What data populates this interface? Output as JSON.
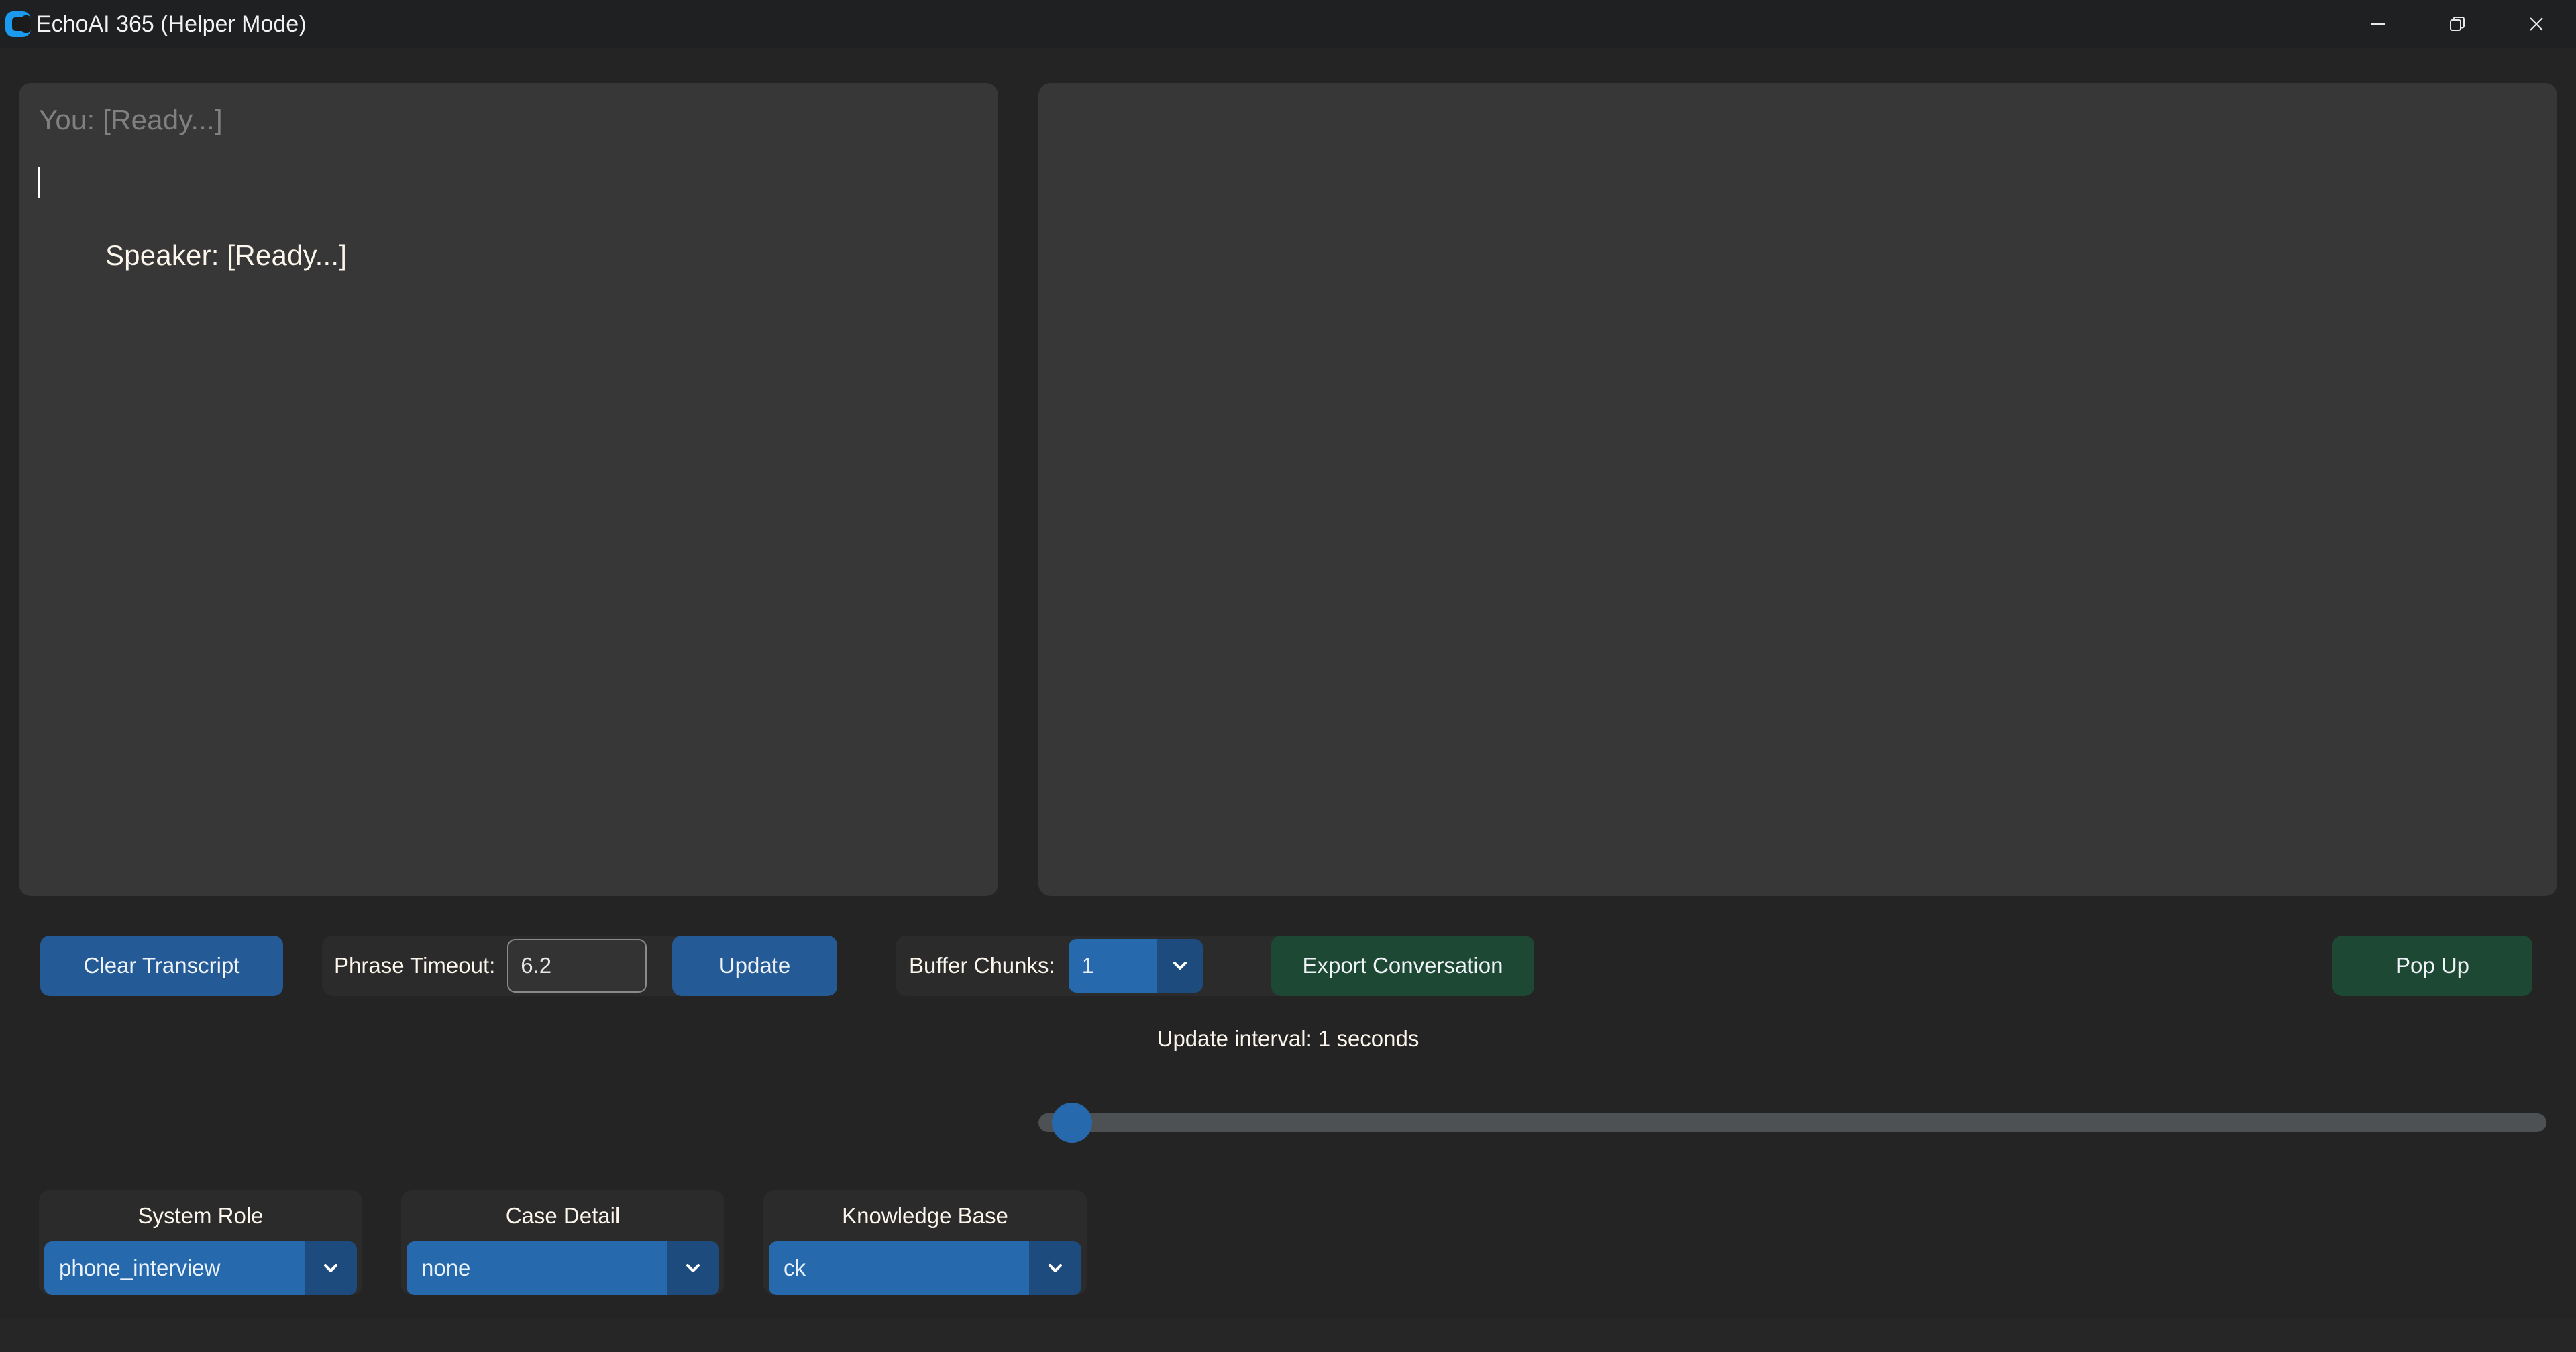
{
  "window": {
    "title": "EchoAI 365 (Helper Mode)",
    "logo_icon": "echoai-logo-icon",
    "controls": {
      "minimize_icon": "minimize-icon",
      "restore_icon": "restore-icon",
      "close_icon": "close-icon"
    }
  },
  "transcript": {
    "you_line": "You: [Ready...]",
    "speaker_line": "Speaker: [Ready...]"
  },
  "response_panel": {
    "content": ""
  },
  "toolbar": {
    "clear_transcript_label": "Clear Transcript",
    "phrase_timeout_label": "Phrase Timeout:",
    "phrase_timeout_value": "6.2",
    "update_label": "Update",
    "buffer_chunks_label": "Buffer Chunks:",
    "buffer_chunks_value": "1",
    "export_conversation_label": "Export Conversation",
    "popup_label": "Pop Up",
    "chevron_icon": "chevron-down-icon"
  },
  "interval": {
    "label": "Update interval: 1 seconds",
    "value": 1,
    "min": 1,
    "max": 30
  },
  "selectors": [
    {
      "title": "System Role",
      "value": "phone_interview",
      "chevron_icon": "chevron-down-icon"
    },
    {
      "title": "Case Detail",
      "value": "none",
      "chevron_icon": "chevron-down-icon"
    },
    {
      "title": "Knowledge Base",
      "value": "ck",
      "chevron_icon": "chevron-down-icon"
    }
  ],
  "colors": {
    "background": "#242424",
    "titlebar": "#1f2022",
    "panel": "#373737",
    "accent_blue": "#2669ad",
    "button_blue": "#245a95",
    "button_green": "#1d4834",
    "slider_track": "#4e5154"
  }
}
